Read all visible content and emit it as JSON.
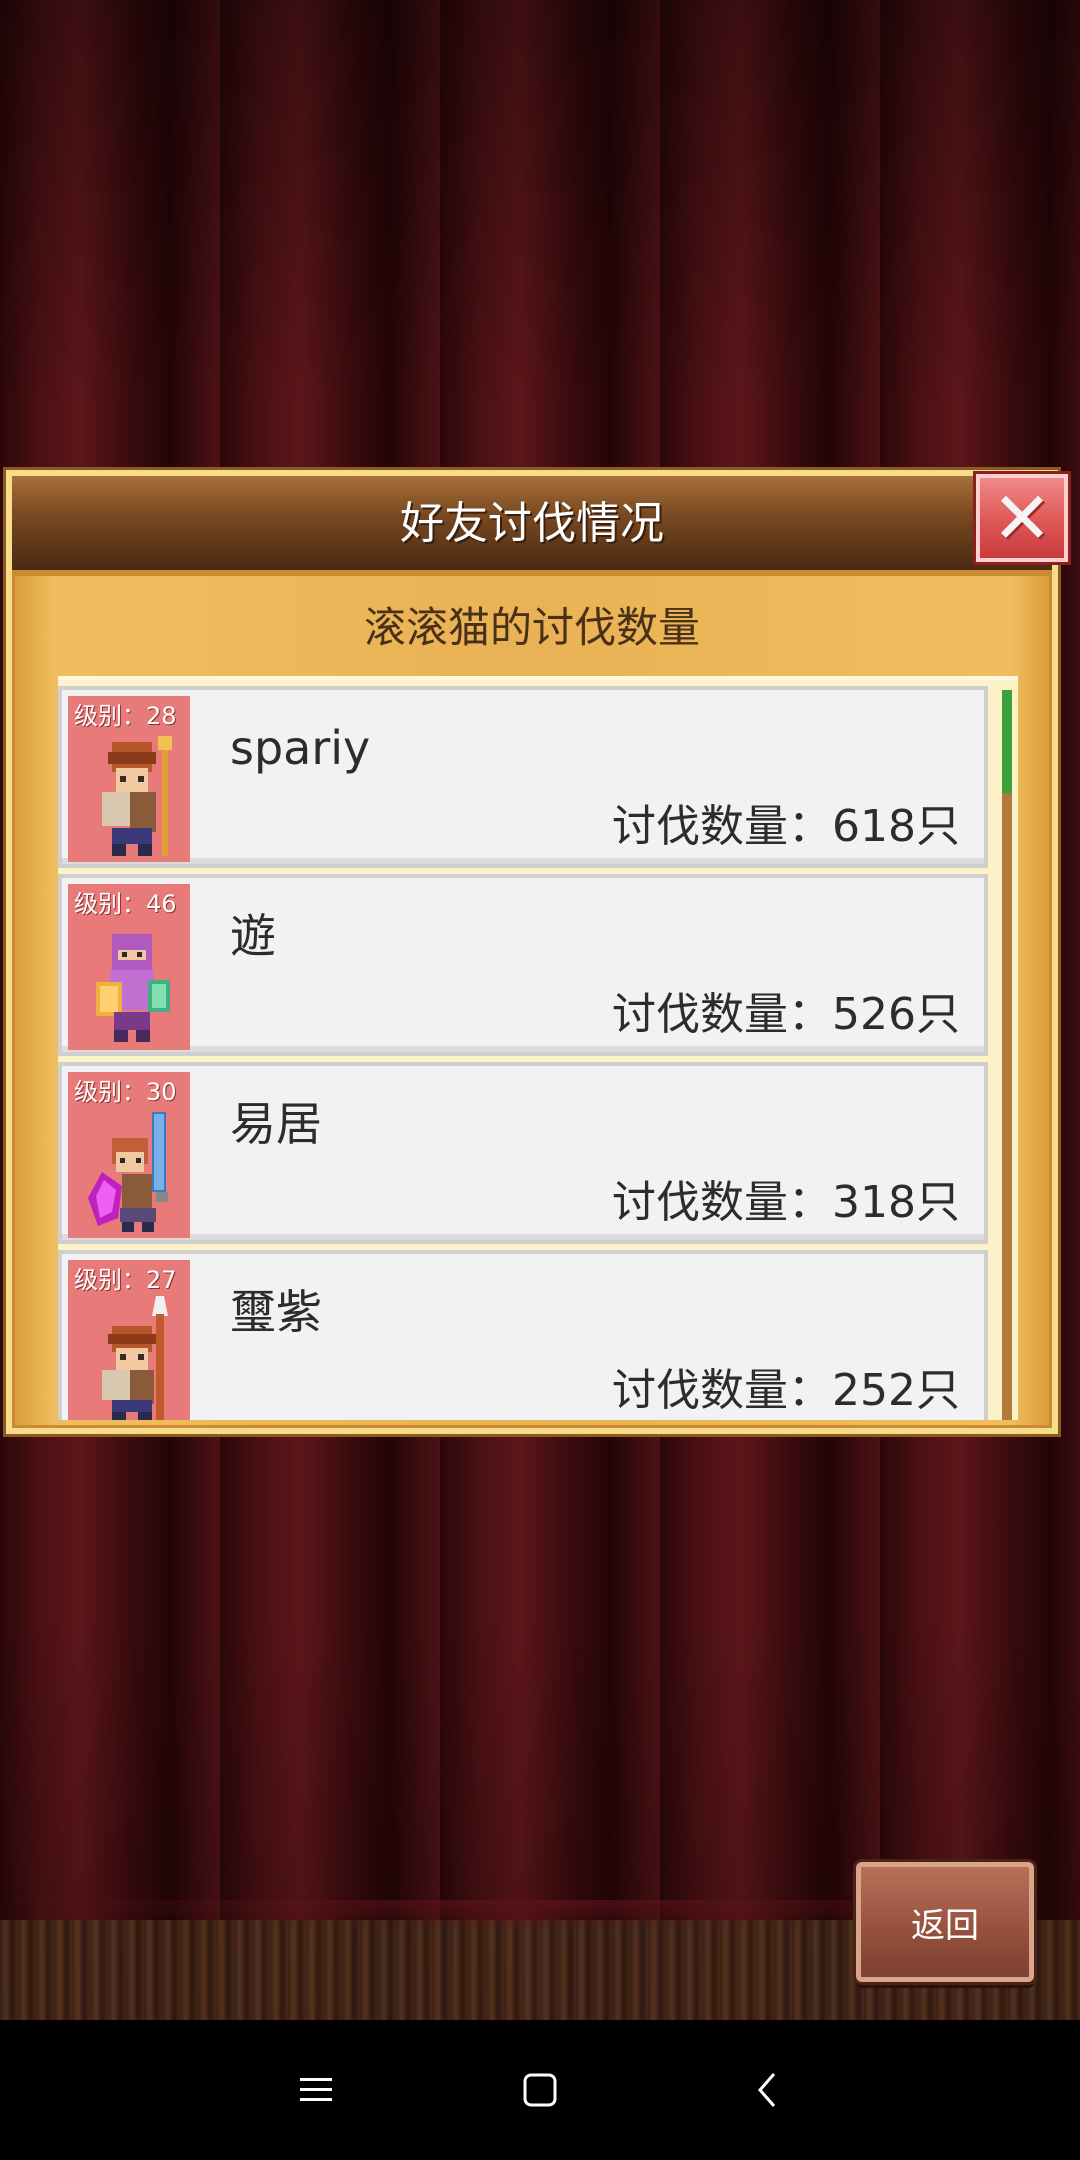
{
  "dialog": {
    "title": "好友讨伐情况",
    "close_icon": "close-icon",
    "subtitle": "滚滚猫的讨伐数量"
  },
  "friends": [
    {
      "level": "级别：28",
      "name": "spariy",
      "kills": "讨伐数量：618只",
      "avatar": "warrior-sprite-icon"
    },
    {
      "level": "级别：46",
      "name": "遊",
      "kills": "讨伐数量：526只",
      "avatar": "ninja-sprite-icon"
    },
    {
      "level": "级别：30",
      "name": "易居",
      "kills": "讨伐数量：318只",
      "avatar": "mage-sprite-icon"
    },
    {
      "level": "级别：27",
      "name": "璽紫",
      "kills": "讨伐数量：252只",
      "avatar": "warrior-sprite-icon"
    }
  ],
  "scroll": {
    "position_fraction": 0.0,
    "visible_fraction": 0.14
  },
  "return_button": {
    "label": "返回"
  },
  "nav_bar": {
    "icons": [
      "menu-icon",
      "home-icon",
      "back-icon"
    ]
  },
  "colors": {
    "close_red": "#e05a5a",
    "avatar_bg": "#e87a7a",
    "scroll_thumb": "#3aa23a"
  }
}
